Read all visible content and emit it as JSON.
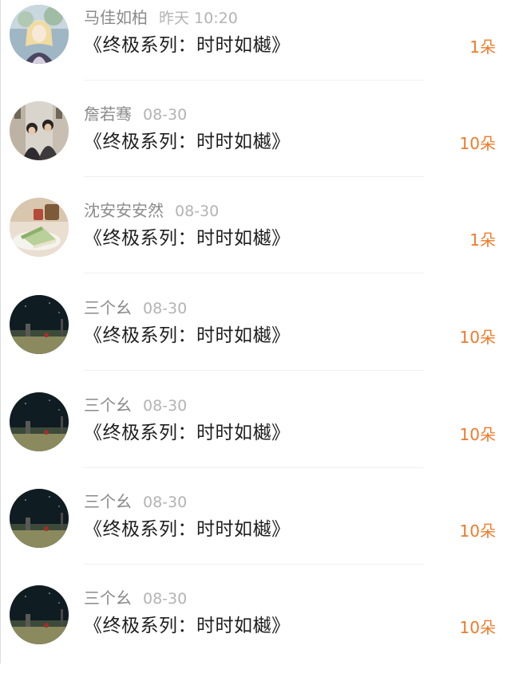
{
  "items": [
    {
      "name": "马佳如柏",
      "time": "昨天 10:20",
      "title": "《终极系列：时时如樾》",
      "gift": "1朵",
      "avatar": "anime-girl-avatar"
    },
    {
      "name": "詹若骞",
      "time": "08-30",
      "title": "《终极系列：时时如樾》",
      "gift": "10朵",
      "avatar": "couple-photo-avatar"
    },
    {
      "name": "沈安安安然",
      "time": "08-30",
      "title": "《终极系列：时时如樾》",
      "gift": "1朵",
      "avatar": "cake-photo-avatar"
    },
    {
      "name": "三个幺",
      "time": "08-30",
      "title": "《终极系列：时时如樾》",
      "gift": "10朵",
      "avatar": "dark-landscape-avatar"
    },
    {
      "name": "三个幺",
      "time": "08-30",
      "title": "《终极系列：时时如樾》",
      "gift": "10朵",
      "avatar": "dark-landscape-avatar"
    },
    {
      "name": "三个幺",
      "time": "08-30",
      "title": "《终极系列：时时如樾》",
      "gift": "10朵",
      "avatar": "dark-landscape-avatar"
    },
    {
      "name": "三个幺",
      "time": "08-30",
      "title": "《终极系列：时时如樾》",
      "gift": "10朵",
      "avatar": "dark-landscape-avatar"
    }
  ],
  "colors": {
    "gift": "#ee7b2b",
    "name": "#8a8a8a",
    "time": "#b3b3b3",
    "title": "#1f1f1f"
  }
}
